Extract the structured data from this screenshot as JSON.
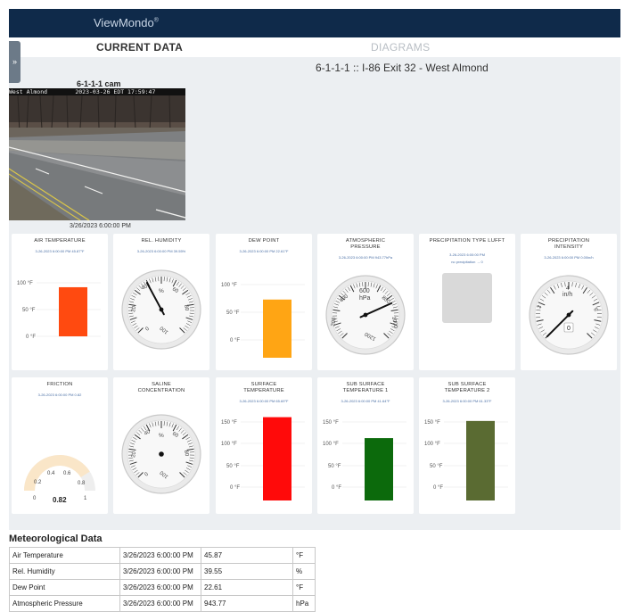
{
  "app": {
    "brand": "ViewMondo",
    "brand_mark": "®"
  },
  "tabs": [
    {
      "label": "CURRENT DATA",
      "active": true
    },
    {
      "label": "DIAGRAMS",
      "active": false
    }
  ],
  "sidebar_toggle": {
    "icon": "chevron-right-icon",
    "glyph": "»"
  },
  "station": {
    "title": "6-1-1-1 :: I-86 Exit 32 - West Almond"
  },
  "camera": {
    "title": "6-1-1-1 cam",
    "overlay": "West Almond        2023-03-26 EDT 17:59:47",
    "timestamp": "3/26/2023 6:00:00 PM"
  },
  "colors": {
    "topbar": "#0f2a4a",
    "air_temp_bar": "#ff4a10",
    "dew_point_bar": "#ffa514",
    "surface_temp_bar": "#ff0a0a",
    "sub1_bar": "#0c6a0c",
    "sub2_bar": "#5a6b32",
    "friction_fill": "#fae6c8",
    "needle": "#111111"
  },
  "cards": {
    "air_temperature": {
      "title": "AIR TEMPERATURE",
      "subtitle": "3-26-2023 6:00:00 PM 45.87°F",
      "ticks": [
        "100 °F",
        "50 °F",
        "0 °F"
      ],
      "value": 45.87
    },
    "rel_humidity": {
      "title": "REL. HUMIDITY",
      "subtitle": "3-26-2023 6:00:00 PM 39.55%",
      "labels": [
        "0",
        "20",
        "40",
        "%",
        "60",
        "80",
        "100"
      ],
      "value": 39.55
    },
    "dew_point": {
      "title": "DEW POINT",
      "subtitle": "3-26-2023 6:00:00 PM 22.61°F",
      "ticks": [
        "100 °F",
        "50 °F",
        "0 °F"
      ],
      "value": 22.61
    },
    "atmospheric_pressure": {
      "title_line1": "ATMOSPHERIC",
      "title_line2": "PRESSURE",
      "subtitle": "3-26-2023 6:00:00 PM 943.77hPa",
      "labels": [
        "200",
        "400",
        "600",
        "hPa",
        "800",
        "1000",
        "1200"
      ],
      "value": 943.77
    },
    "precip_type": {
      "title": "PRECIPITATION TYPE LUFFT",
      "subtitle": "3-26-2023 6:00:00 PM",
      "subtitle2": "no precipitation → 0"
    },
    "precip_intensity": {
      "title_line1": "PRECIPITATION",
      "title_line2": "INTENSITY",
      "subtitle": "3-26-2023 6:00:00 PM 0.00in/h",
      "labels": [
        "2",
        "4",
        "in/h",
        "6"
      ],
      "readout": "0",
      "value": 0
    },
    "friction": {
      "title": "FRICTION",
      "subtitle": "3-26-2023 6:00:00 PM 0.82",
      "labels": [
        "0",
        "0.2",
        "0.4",
        "0.6",
        "0.8",
        "1"
      ],
      "readout": "0.82",
      "value": 0.82
    },
    "saline": {
      "title_line1": "SALINE",
      "title_line2": "CONCENTRATION",
      "labels": [
        "0",
        "20",
        "40",
        "%",
        "60",
        "80",
        "100"
      ]
    },
    "surface_temperature": {
      "title_line1": "SURFACE",
      "title_line2": "TEMPERATURE",
      "subtitle": "3-26-2023 6:00:00 PM 65.69°F",
      "ticks": [
        "150 °F",
        "100 °F",
        "50 °F",
        "0 °F"
      ],
      "value": 65.69
    },
    "sub_surface_1": {
      "title_line1": "SUB SURFACE",
      "title_line2": "TEMPERATURE 1",
      "subtitle": "3-26-2023 6:00:00 PM 41.64°F",
      "ticks": [
        "150 °F",
        "100 °F",
        "50 °F",
        "0 °F"
      ],
      "value": 41.64
    },
    "sub_surface_2": {
      "title_line1": "SUB SURFACE",
      "title_line2": "TEMPERATURE 2",
      "subtitle": "3-26-2023 6:00:00 PM 61.33°F",
      "ticks": [
        "150 °F",
        "100 °F",
        "50 °F",
        "0 °F"
      ],
      "value": 61.33
    }
  },
  "met": {
    "title": "Meteorological Data",
    "rows": [
      {
        "name": "Air Temperature",
        "time": "3/26/2023 6:00:00 PM",
        "value": "45.87",
        "unit": "°F"
      },
      {
        "name": "Rel. Humidity",
        "time": "3/26/2023 6:00:00 PM",
        "value": "39.55",
        "unit": "%"
      },
      {
        "name": "Dew Point",
        "time": "3/26/2023 6:00:00 PM",
        "value": "22.61",
        "unit": "°F"
      },
      {
        "name": "Atmospheric Pressure",
        "time": "3/26/2023 6:00:00 PM",
        "value": "943.77",
        "unit": "hPa"
      }
    ]
  }
}
